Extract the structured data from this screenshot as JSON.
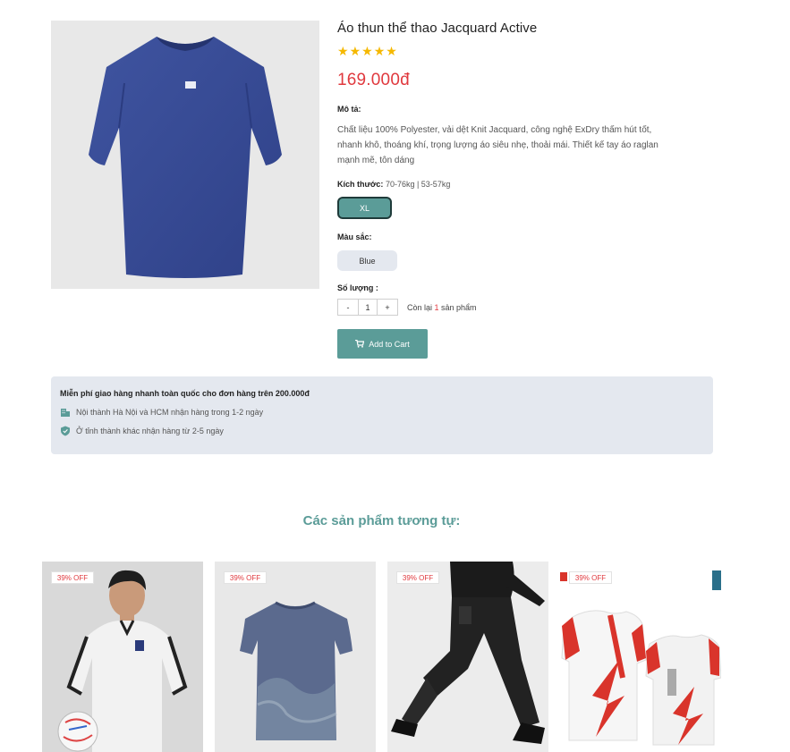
{
  "product": {
    "title": "Áo thun thể thao Jacquard Active",
    "rating": 5,
    "stars": [
      "★",
      "★",
      "★",
      "★",
      "★"
    ],
    "price": "169.000đ",
    "image_icon": "tshirt-icon",
    "color_image": "#3a4e95"
  },
  "description": {
    "label": "Mô tả:",
    "text": "Chất liệu 100% Polyester, vải dệt Knit Jacquard, công nghệ ExDry thấm hút tốt, nhanh khô, thoáng khí, trọng lượng áo siêu nhẹ, thoải mái. Thiết kế tay áo raglan mạnh mẽ, tôn dáng"
  },
  "size": {
    "label": "Kích thước:",
    "hint": "70-76kg | 53-57kg",
    "selected": "XL"
  },
  "color": {
    "label": "Màu sắc:",
    "selected": "Blue"
  },
  "quantity": {
    "label": "Số lượng :",
    "minus": "-",
    "value": "1",
    "plus": "+",
    "stock_prefix": "Còn lại ",
    "stock_count": "1",
    "stock_suffix": " sản phẩm"
  },
  "cart": {
    "label": "Add to Cart",
    "icon": "cart-icon"
  },
  "shipping": {
    "title": "Miễn phí giao hàng nhanh toàn quốc cho đơn hàng trên 200.000đ",
    "rows": [
      {
        "icon": "building-icon",
        "text": "Nội thành Hà Nội và HCM nhận hàng trong 1-2 ngày"
      },
      {
        "icon": "shield-icon",
        "text": "Ở tỉnh thành khác nhận hàng từ 2-5 ngày"
      }
    ]
  },
  "related": {
    "title": "Các sản phẩm tương tự:",
    "items": [
      {
        "badge": "39% OFF"
      },
      {
        "badge": "39% OFF"
      },
      {
        "badge": "39% OFF"
      },
      {
        "badge": "39% OFF"
      }
    ]
  },
  "colors": {
    "accent": "#5b9c98",
    "price": "#e0393e",
    "star": "#f5b800",
    "panel": "#e4e8ef"
  }
}
